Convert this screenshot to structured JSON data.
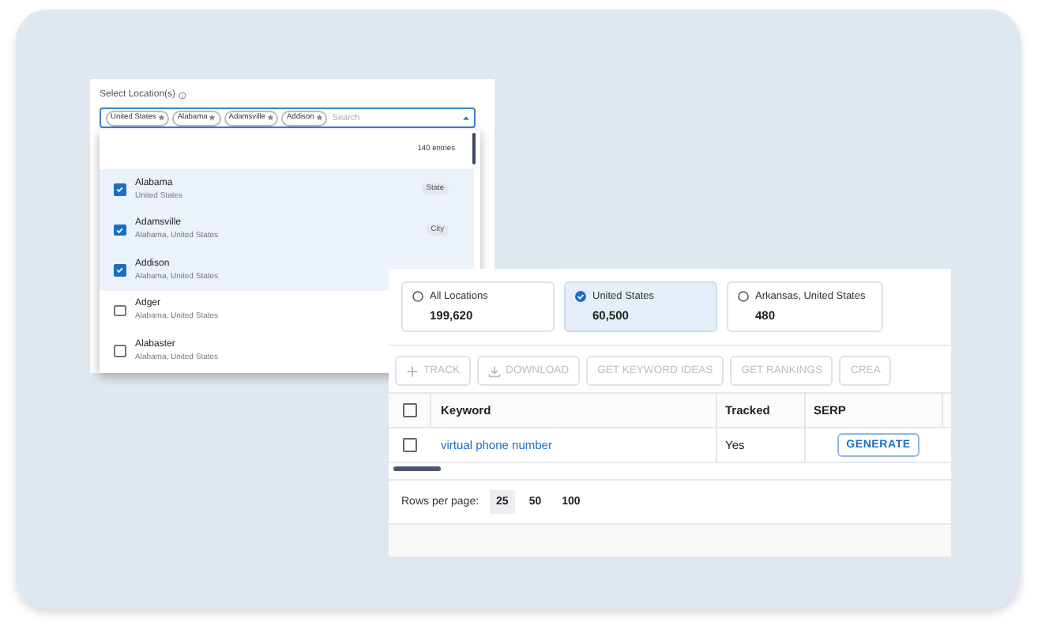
{
  "location_picker": {
    "label": "Select Location(s)",
    "chips": [
      "United States",
      "Alabama",
      "Adamsville",
      "Addison"
    ],
    "placeholder": "Search",
    "entries_count": "140 entries",
    "options": [
      {
        "name": "Alabama",
        "region": "United States",
        "badge": "State",
        "checked": true
      },
      {
        "name": "Adamsville",
        "region": "Alabama, United States",
        "badge": "City",
        "checked": true
      },
      {
        "name": "Addison",
        "region": "Alabama, United States",
        "checked": true
      },
      {
        "name": "Adger",
        "region": "Alabama, United States",
        "checked": false
      },
      {
        "name": "Alabaster",
        "region": "Alabama, United States",
        "checked": false
      }
    ]
  },
  "location_cards": [
    {
      "name": "All Locations",
      "volume": "199,620",
      "selected": false
    },
    {
      "name": "United States",
      "volume": "60,500",
      "selected": true
    },
    {
      "name": "Arkansas, United States",
      "volume": "480",
      "selected": false
    }
  ],
  "toolbar": [
    {
      "label": "TRACK",
      "disabled": true
    },
    {
      "label": "DOWNLOAD",
      "disabled": true
    },
    {
      "label": "GET KEYWORD IDEAS",
      "disabled": true
    },
    {
      "label": "GET RANKINGS",
      "disabled": true
    },
    {
      "label": "CREA",
      "disabled": true
    }
  ],
  "table": {
    "header_checked": false,
    "columns": [
      "Keyword",
      "Tracked",
      "SERP"
    ],
    "rows": [
      {
        "checked": false,
        "keyword": "virtual phone number",
        "tracked": "Yes",
        "serp_button": "GENERATE"
      }
    ]
  },
  "pagination": {
    "label": "Rows per page:",
    "options": [
      {
        "label": "25",
        "selected": true
      },
      {
        "label": "50",
        "selected": false
      },
      {
        "label": "100",
        "selected": false
      }
    ]
  }
}
